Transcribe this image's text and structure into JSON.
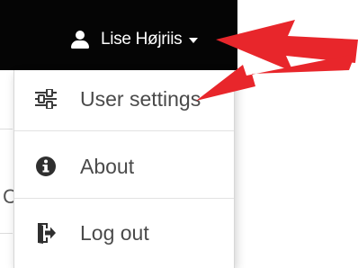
{
  "navbar": {
    "user_name": "Lise Højriis",
    "icons": {
      "user": "user-icon",
      "caret": "caret-down-icon"
    },
    "background": "#050505",
    "text_color": "#ffffff"
  },
  "dropdown": {
    "items": [
      {
        "label": "User settings",
        "icon": "sliders-icon"
      },
      {
        "label": "About",
        "icon": "info-circle-icon"
      },
      {
        "label": "Log out",
        "icon": "sign-out-icon"
      }
    ]
  },
  "background_page": {
    "partial_letter": "C"
  },
  "annotation": {
    "color": "#e8262b",
    "description": "red arrows pointing at user menu"
  }
}
